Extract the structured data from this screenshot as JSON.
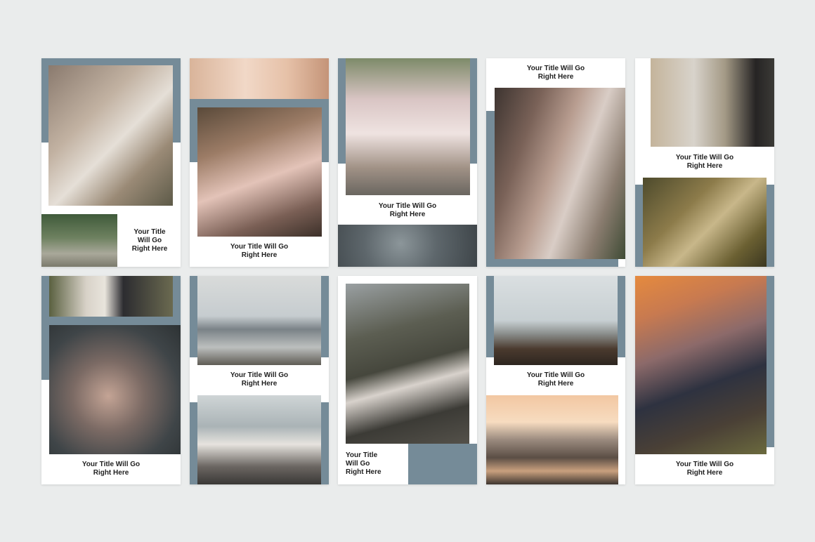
{
  "caption": "Your Title Will Go\nRight Here",
  "caption_short": "Your Title\nWill Go\nRight Here",
  "accent_color": "#758b98",
  "background_color": "#eaecec",
  "photos": [
    "bride-holding-bouquet",
    "garden-chalkboard-sign",
    "hands-taking-phone-photo",
    "bride-with-crowd-of-guests",
    "bridesmaids-with-balloons",
    "wedding-rings-on-stone",
    "groom-and-bride-close-up",
    "couple-in-field",
    "bride-and-groom-in-grass",
    "couple-holding-hands",
    "hands-with-wedding-ring",
    "couple-by-the-sea",
    "couple-walking-on-beach",
    "couple-on-rocks-in-forest",
    "couple-on-coastal-rock",
    "couple-at-sunset-beach",
    "couple-watching-sunset"
  ]
}
